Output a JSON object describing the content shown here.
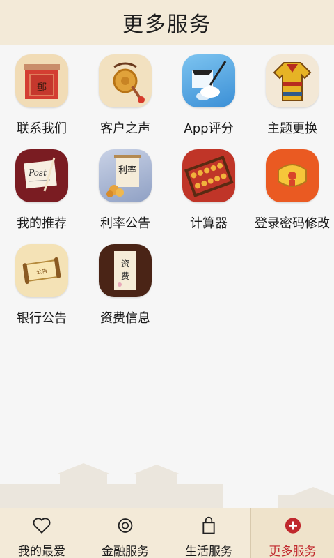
{
  "header": {
    "title": "更多服务"
  },
  "services": [
    {
      "label": "联系我们",
      "icon": "envelope-icon"
    },
    {
      "label": "客户之声",
      "icon": "gong-icon"
    },
    {
      "label": "App评分",
      "icon": "quill-brush-icon"
    },
    {
      "label": "主题更换",
      "icon": "robe-icon"
    },
    {
      "label": "我的推荐",
      "icon": "postcard-icon"
    },
    {
      "label": "利率公告",
      "icon": "scroll-icon"
    },
    {
      "label": "计算器",
      "icon": "abacus-icon"
    },
    {
      "label": "登录密码修改",
      "icon": "lock-ornament-icon"
    },
    {
      "label": "银行公告",
      "icon": "notice-scroll-icon"
    },
    {
      "label": "资费信息",
      "icon": "fee-book-icon"
    }
  ],
  "icon_text": {
    "envelope": "郵",
    "postcard": "Post",
    "scroll": "利率",
    "notice": "公告",
    "fee_top": "资",
    "fee_bottom": "费"
  },
  "bottom_nav": [
    {
      "label": "我的最爱",
      "icon": "heart-icon",
      "active": false
    },
    {
      "label": "金融服务",
      "icon": "coin-icon",
      "active": false
    },
    {
      "label": "生活服务",
      "icon": "shopping-bag-icon",
      "active": false
    },
    {
      "label": "更多服务",
      "icon": "plus-circle-icon",
      "active": true
    }
  ],
  "colors": {
    "header_bg": "#f3ead8",
    "active_red": "#c0282d"
  }
}
